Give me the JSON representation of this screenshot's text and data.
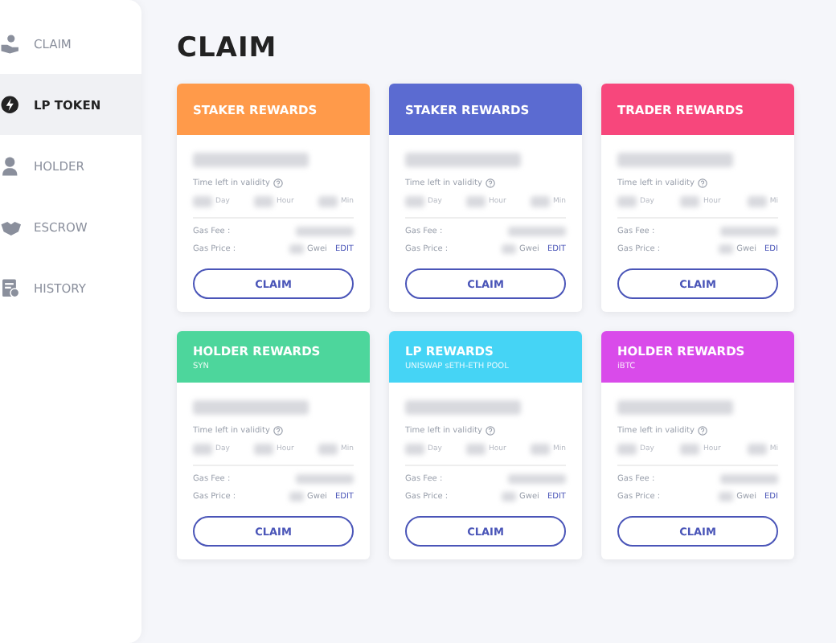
{
  "sidebar": {
    "items": [
      {
        "label": "CLAIM",
        "selected": false
      },
      {
        "label": "LP TOKEN",
        "selected": true
      },
      {
        "label": "HOLDER",
        "selected": false
      },
      {
        "label": "ESCROW",
        "selected": false
      },
      {
        "label": "HISTORY",
        "selected": false
      }
    ]
  },
  "page_title": "CLAIM",
  "cards": [
    {
      "title": "STAKER REWARDS",
      "color": "#ff9a4a",
      "validity_label": "Time left in validity",
      "units": [
        "Day",
        "Hour",
        "Min"
      ],
      "gas_fee_label": "Gas Fee  :",
      "gas_price_label": "Gas Price :",
      "gwei": "Gwei",
      "edit": "EDIT",
      "button": "CLAIM"
    },
    {
      "title": "STAKER REWARDS",
      "color": "#5b6bd1",
      "validity_label": "Time left in validity",
      "units": [
        "Day",
        "Hour",
        "Min"
      ],
      "gas_fee_label": "Gas Fee  :",
      "gas_price_label": "Gas Price :",
      "gwei": "Gwei",
      "edit": "EDIT",
      "button": "CLAIM"
    },
    {
      "title": "TRADER REWARDS",
      "color": "#f7477c",
      "validity_label": "Time left in validity",
      "units": [
        "Day",
        "Hour",
        "Mi"
      ],
      "gas_fee_label": "Gas Fee  :",
      "gas_price_label": "Gas Price :",
      "gwei": "Gwei",
      "edit": "EDI",
      "button": "CLAIM"
    },
    {
      "title": "HOLDER REWARDS",
      "subtitle": "SYN",
      "color": "#4dd69c",
      "validity_label": "Time left in validity",
      "units": [
        "Day",
        "Hour",
        "Min"
      ],
      "gas_fee_label": "Gas Fee  :",
      "gas_price_label": "Gas Price :",
      "gwei": "Gwei",
      "edit": "EDIT",
      "button": "CLAIM"
    },
    {
      "title": "LP REWARDS",
      "subtitle": "UNISWAP sETH-ETH POOL",
      "color": "#45d4f5",
      "validity_label": "Time left in validity",
      "units": [
        "Day",
        "Hour",
        "Min"
      ],
      "gas_fee_label": "Gas Fee  :",
      "gas_price_label": "Gas Price :",
      "gwei": "Gwei",
      "edit": "EDIT",
      "button": "CLAIM"
    },
    {
      "title": "HOLDER REWARDS",
      "subtitle": "iBTC",
      "color": "#d94bea",
      "validity_label": "Time left in validity",
      "units": [
        "Day",
        "Hour",
        "Mi"
      ],
      "gas_fee_label": "Gas Fee  :",
      "gas_price_label": "Gas Price :",
      "gwei": "Gwei",
      "edit": "EDI",
      "button": "CLAIM"
    }
  ]
}
